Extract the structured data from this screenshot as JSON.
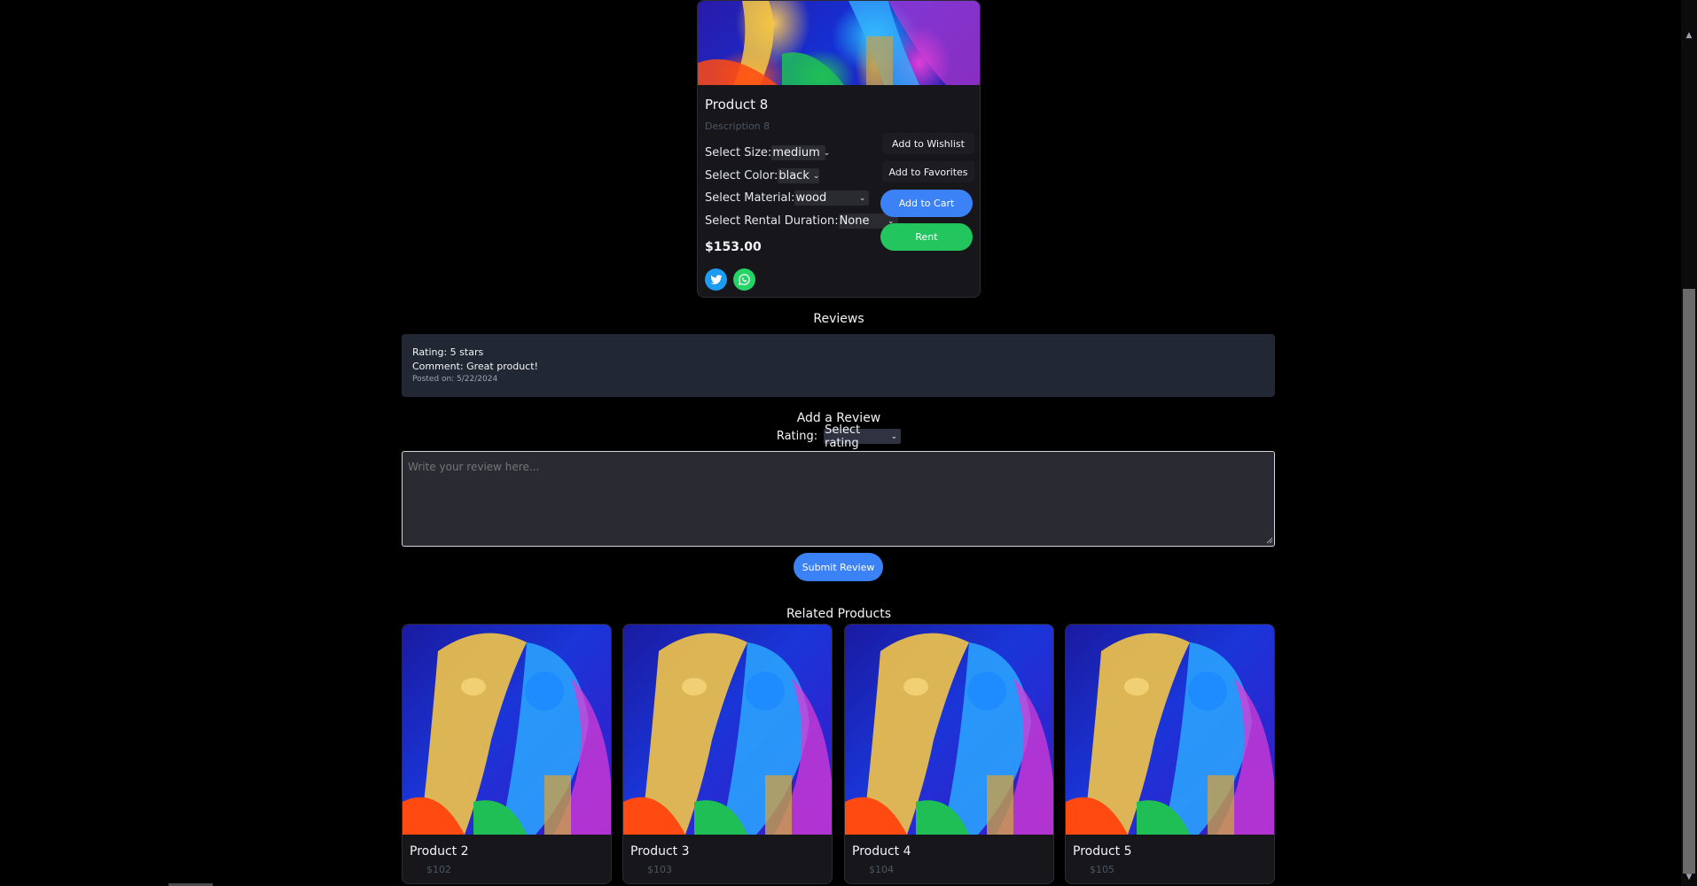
{
  "product": {
    "title": "Product 8",
    "description": "Description 8",
    "options": [
      {
        "label": "Select Size:",
        "value": "medium"
      },
      {
        "label": "Select Color:",
        "value": "black"
      },
      {
        "label": "Select Material:",
        "value": "wood"
      },
      {
        "label": "Select Rental Duration:",
        "value": "None"
      }
    ],
    "price": "$153.00",
    "buttons": {
      "wishlist": "Add to Wishlist",
      "favorites": "Add to Favorites",
      "cart": "Add to Cart",
      "rent": "Rent"
    },
    "share_icons": [
      "twitter-icon",
      "whatsapp-icon"
    ]
  },
  "reviews": {
    "title": "Reviews",
    "items": [
      {
        "rating": "Rating: 5 stars",
        "comment": "Comment: Great product!",
        "date": "Posted on: 5/22/2024"
      }
    ]
  },
  "add_review": {
    "title": "Add a Review",
    "rating_label": "Rating:",
    "rating_value": "Select rating",
    "textarea_placeholder": "Write your review here...",
    "submit_label": "Submit Review"
  },
  "related": {
    "title": "Related Products",
    "items": [
      {
        "name": "Product 2",
        "price": "$102"
      },
      {
        "name": "Product 3",
        "price": "$103"
      },
      {
        "name": "Product 4",
        "price": "$104"
      },
      {
        "name": "Product 5",
        "price": "$105"
      }
    ]
  },
  "colors": {
    "accent_blue": "#3b82f6",
    "accent_green": "#22c55e",
    "twitter": "#1d9bf0",
    "whatsapp": "#25d366",
    "background": "#000000",
    "card": "#17171b"
  }
}
